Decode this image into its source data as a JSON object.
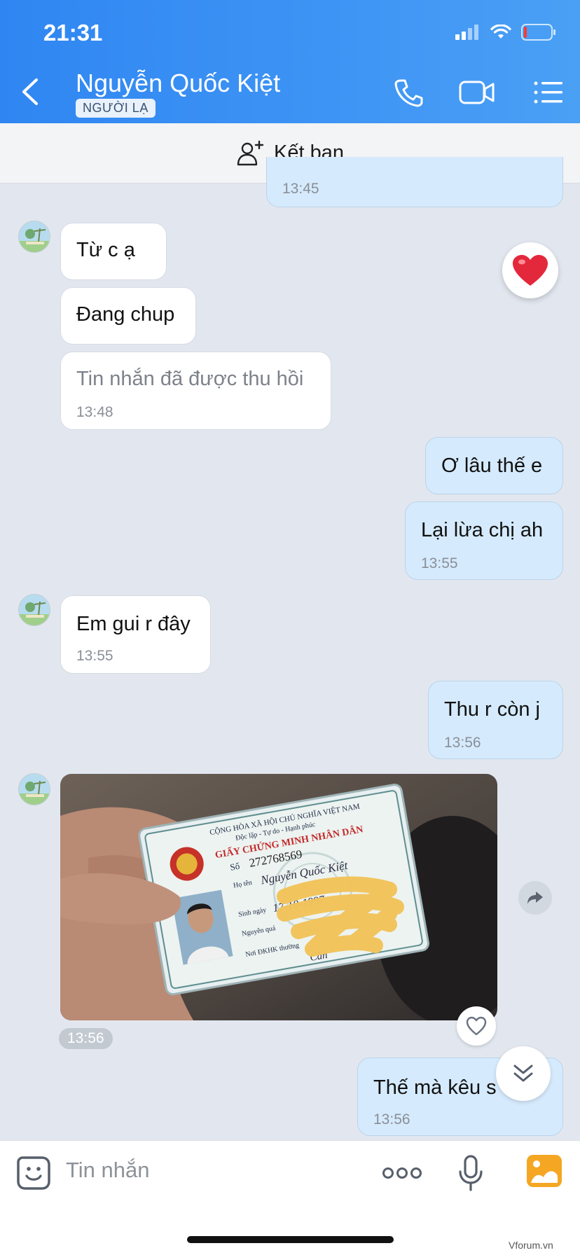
{
  "status_bar": {
    "time": "21:31"
  },
  "header": {
    "contact_name": "Nguyễn Quốc Kiệt",
    "badge": "NGƯỜI LẠ",
    "accent_color": "#3b8ff3"
  },
  "friend_bar": {
    "label": "Kết bạn"
  },
  "messages": [
    {
      "side": "out",
      "time": "13:45"
    },
    {
      "side": "in",
      "text": "Từ c ạ"
    },
    {
      "side": "in",
      "text": "Đang chup"
    },
    {
      "side": "in",
      "text": "Tin nhắn đã được thu hồi",
      "time": "13:48",
      "recalled": true
    },
    {
      "side": "out",
      "text": "Ơ lâu thế e"
    },
    {
      "side": "out",
      "text": "Lại lừa chị ah",
      "time": "13:55"
    },
    {
      "side": "in",
      "text": "Em gui r đây",
      "time": "13:55"
    },
    {
      "side": "out",
      "text": "Thu r còn j",
      "time": "13:56"
    },
    {
      "side": "in",
      "type": "photo",
      "time": "13:56"
    },
    {
      "side": "out",
      "text": "Thế mà kêu s",
      "time": "13:56"
    }
  ],
  "id_card": {
    "line1": "CỘNG HÒA XÃ HỘI CHỦ NGHĨA VIỆT NAM",
    "line2": "Độc lập - Tự do - Hạnh phúc",
    "title": "GIẤY CHỨNG MINH NHÂN DÂN",
    "number_label": "Số",
    "number": "272768569",
    "name_label": "Họ tên",
    "name": "Nguyễn Quốc Kiệt",
    "dob_label": "Sinh ngày",
    "dob": "17-10-1997",
    "origin_label": "Nguyên quá",
    "residence_label": "Nơi ĐKHK thường",
    "residence_fragment": "Cần"
  },
  "input": {
    "placeholder": "Tin nhắn"
  },
  "icons": {
    "reaction": "heart-icon",
    "call": "phone-icon",
    "video": "video-icon",
    "menu": "list-menu-icon"
  },
  "watermark": "Vforum.vn"
}
